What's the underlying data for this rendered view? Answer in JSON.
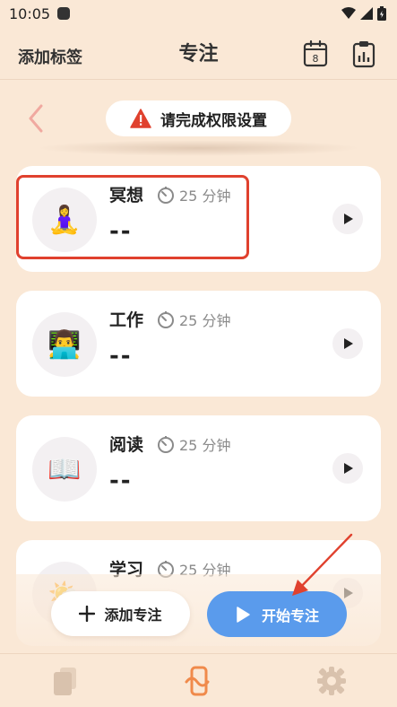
{
  "status_bar": {
    "time": "10:05"
  },
  "header": {
    "left_action": "添加标签",
    "title": "专注",
    "calendar_day": "8"
  },
  "notice": {
    "text": "请完成权限设置"
  },
  "cards": [
    {
      "title": "冥想",
      "duration": "25 分钟",
      "value": "--",
      "icon": "meditation-emoji",
      "glyph": "🧘‍♀️"
    },
    {
      "title": "工作",
      "duration": "25 分钟",
      "value": "--",
      "icon": "technologist-emoji",
      "glyph": "👨‍💻"
    },
    {
      "title": "阅读",
      "duration": "25 分钟",
      "value": "--",
      "icon": "open-book-emoji",
      "glyph": "📖"
    },
    {
      "title": "学习",
      "duration": "25 分钟",
      "value": "--",
      "icon": "sun-emoji",
      "glyph": "🌤️"
    }
  ],
  "actions": {
    "add_label": "添加专注",
    "start_label": "开始专注"
  },
  "colors": {
    "background": "#fae8d6",
    "accent_blue": "#5a9bec",
    "highlight_red": "#e0412e",
    "warning_red": "#e0412e",
    "tab_active": "#f08a4b"
  }
}
